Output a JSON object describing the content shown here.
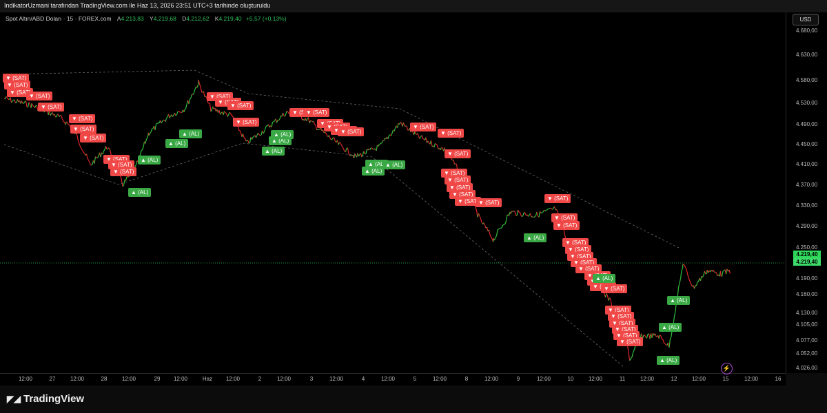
{
  "header": {
    "title": "IndikatorUzmani tarafından TradingView.com ile Haz 13, 2026 23:51 UTC+3 tarihinde oluşturuldu"
  },
  "legend": {
    "symbol": "Spot Altın/ABD Doları · 15 · FOREX.com",
    "o_key": "A",
    "o_val": "4.213,83",
    "h_key": "Y",
    "h_val": "4.219,68",
    "l_key": "D",
    "l_val": "4.212,62",
    "c_key": "K",
    "c_val": "4.219,40",
    "chg": "+5,57 (+0,13%)"
  },
  "price_axis": {
    "currency": "USD",
    "labels": [
      "4.680,00",
      "4.630,00",
      "4.580,00",
      "4.530,00",
      "4.490,00",
      "4.450,00",
      "4.410,00",
      "4.370,00",
      "4.330,00",
      "4.290,00",
      "4.250,00",
      "4.190,00",
      "4.160,00",
      "4.130,00",
      "4.105,00",
      "4.077,00",
      "4.052,00",
      "4.026,00"
    ],
    "last_price": "4.219,40"
  },
  "time_axis": {
    "labels": [
      "12:00",
      "27",
      "12:00",
      "28",
      "12:00",
      "29",
      "12:00",
      "Haz",
      "12:00",
      "2",
      "12:00",
      "3",
      "12:00",
      "4",
      "12:00",
      "5",
      "12:00",
      "8",
      "12:00",
      "9",
      "12:00",
      "10",
      "12:00",
      "11",
      "12:00",
      "12",
      "12:00",
      "15",
      "12:00",
      "16"
    ]
  },
  "signals": {
    "sell_label": "▼ (SAT)",
    "buy_label": "▲ (AL)"
  },
  "footer": {
    "brand": "TradingView",
    "logo_icon": "tradingview-logo-icon"
  },
  "colors": {
    "up": "#2fbf3a",
    "down": "#e0262a",
    "sell": "#f04747",
    "buy": "#3aa845",
    "last": "#2fd85a"
  }
}
